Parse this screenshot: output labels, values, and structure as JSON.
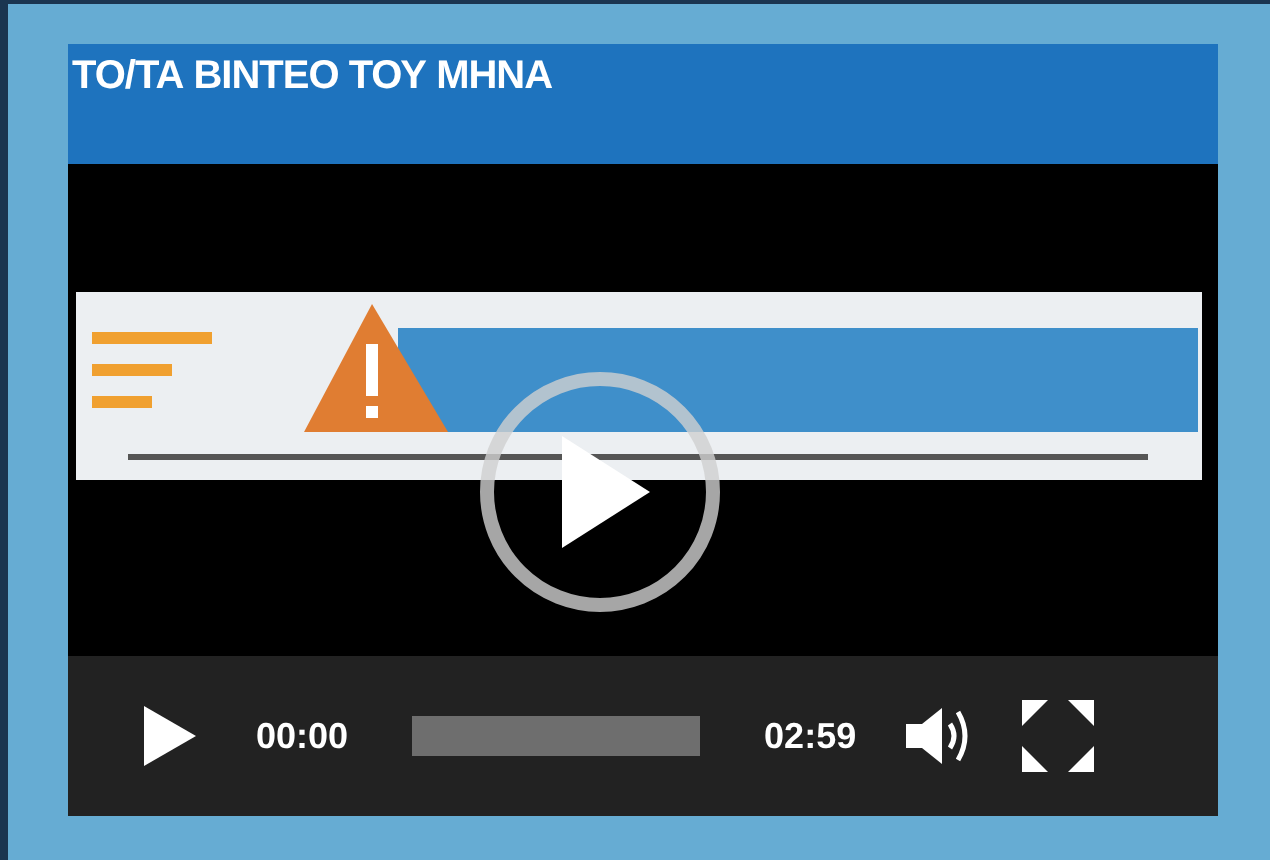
{
  "widget": {
    "title": "ΤΟ/ΤΑ ΒΙΝΤΕΟ ΤΟΥ ΜΗΝΑ"
  },
  "player": {
    "current_time": "00:00",
    "duration": "02:59"
  }
}
